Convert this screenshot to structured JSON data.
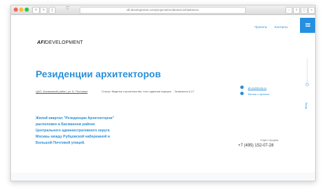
{
  "browser": {
    "url": "afi-development.com/projects/rezidentsii-arhitektorov",
    "back_label": "<",
    "forward_label": ">"
  },
  "header": {
    "logo_text_bold": "AFI",
    "logo_text_rest": "DEVELOPMENT",
    "nav": [
      "Проекты",
      "Контакты"
    ]
  },
  "main": {
    "title": "Резиденции архитекторов",
    "address": "ЦАО, Басманный район, ул. Б. Почтовая",
    "status_label": "Статус:",
    "status_value": "Ведется строительство, есть сданные корпуса",
    "floors_label": "Этажность:",
    "floors_value": "4-17",
    "links": [
      "afi-architects.ru",
      "Фильм о проекте"
    ],
    "description": [
      "Жилой квартал \"Резиденции Архитекторов\"",
      "расположен в Басманном районе",
      "Центрального административного округа",
      "Москвы между Рубцовской набережной и",
      "Большой Почтовой улицей."
    ],
    "sales_label": "Отдел продаж",
    "phone": "+7 (495) 152-07-28"
  },
  "side": {
    "label": "Вход"
  },
  "colors": {
    "accent": "#2b8fd9",
    "menu": "#2490e0"
  }
}
